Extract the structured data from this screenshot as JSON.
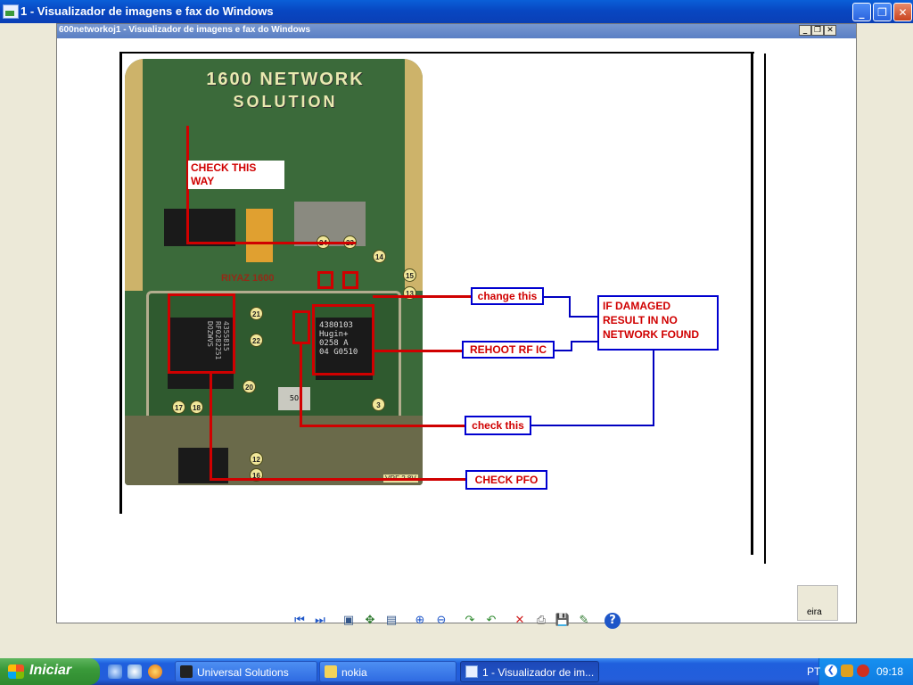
{
  "window": {
    "title": "1 - Visualizador de imagens e fax do Windows",
    "minimize": "_",
    "maximize": "❐",
    "close": "✕"
  },
  "inner_window": {
    "title": "600networkoj1 - Visualizador de imagens e fax do Windows"
  },
  "image": {
    "heading_line1": "1600 NETWORK",
    "heading_line2": "SOLUTION",
    "pcb_mark": "RIYAZ 1600",
    "chip_text_1": "4380103",
    "chip_text_2": "Hugin+",
    "chip_text_3": "0258 A",
    "chip_text_4": "04 G0510",
    "left_chip_text": "4355815 RF0282251 DOZWVS",
    "cap_text": "50",
    "voltage_text": "VRF 2.8V",
    "pins": [
      "24",
      "23",
      "14",
      "15",
      "13",
      "21",
      "22",
      "20",
      "17",
      "18",
      "3",
      "12",
      "16"
    ],
    "annotations": {
      "check_this_way": "CHECK THIS WAY",
      "change_this": "change this",
      "if_damaged": "IF DAMAGED RESULT IN NO NETWORK FOUND",
      "reheat_rf_ic": "REHOOT RF IC",
      "check_this": "check this",
      "check_pfo": "CHECK PFO"
    }
  },
  "corner_fragment": "eira",
  "toolbar": {
    "tools": [
      {
        "name": "previous-image",
        "icon": "⏮"
      },
      {
        "name": "next-image",
        "icon": "⏭"
      },
      {
        "name": "best-fit",
        "icon": "▣"
      },
      {
        "name": "actual-size",
        "icon": "✥"
      },
      {
        "name": "slideshow",
        "icon": "▤"
      },
      {
        "name": "zoom-in",
        "icon": "⊕"
      },
      {
        "name": "zoom-out",
        "icon": "⊖"
      },
      {
        "name": "rotate-clockwise",
        "icon": "↷"
      },
      {
        "name": "rotate-counterclockwise",
        "icon": "↶"
      },
      {
        "name": "delete",
        "icon": "✕"
      },
      {
        "name": "print",
        "icon": "⎙"
      },
      {
        "name": "save",
        "icon": "💾"
      },
      {
        "name": "edit",
        "icon": "✎"
      },
      {
        "name": "help",
        "icon": "?"
      }
    ]
  },
  "taskbar": {
    "start_label": "Iniciar",
    "tasks": [
      {
        "label": "Universal Solutions"
      },
      {
        "label": "nokia"
      },
      {
        "label": "1 - Visualizador de im..."
      }
    ],
    "tray": {
      "language": "PT",
      "clock": "09:18"
    }
  },
  "colors": {
    "annotation_red": "#d00000",
    "annotation_blue": "#0000d0",
    "pcb_green": "#3b6a3a",
    "title_blue": "#0847c2"
  }
}
